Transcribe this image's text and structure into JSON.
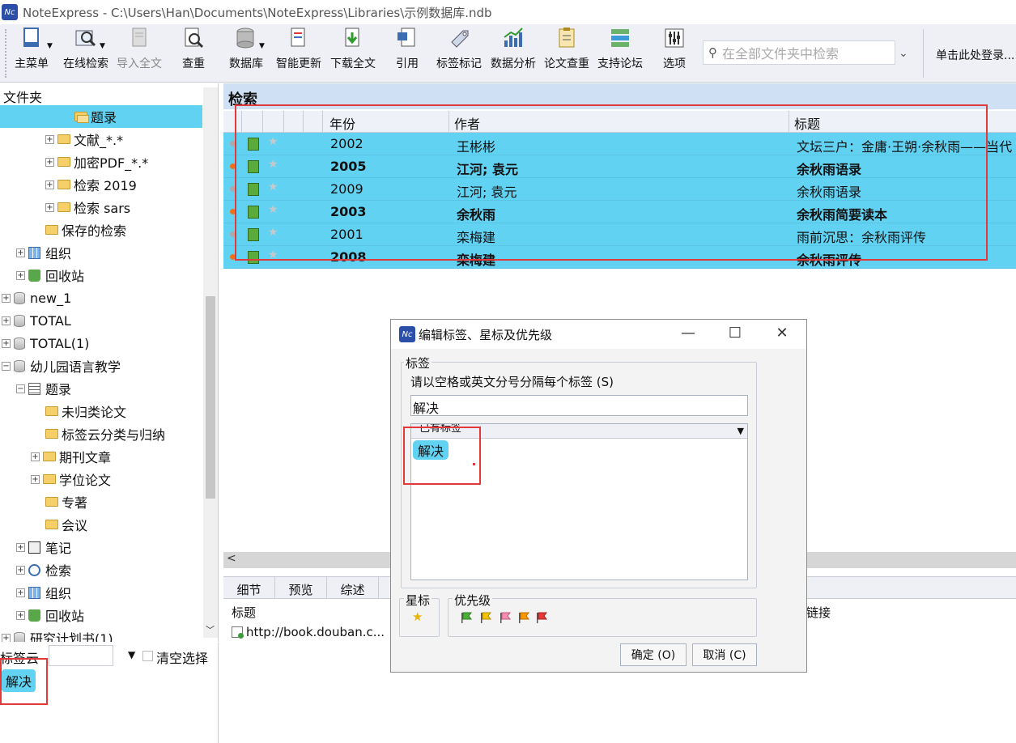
{
  "window": {
    "title": "NoteExpress - C:\\Users\\Han\\Documents\\NoteExpress\\Libraries\\示例数据库.ndb",
    "logo": "Nc"
  },
  "toolbar": {
    "items": [
      "主菜单",
      "在线检索",
      "导入全文",
      "查重",
      "数据库",
      "智能更新",
      "下载全文",
      "引用",
      "标签标记",
      "数据分析",
      "论文查重",
      "支持论坛",
      "选项"
    ],
    "search_placeholder": "在全部文件夹中检索",
    "login": "单击此处登录..."
  },
  "left": {
    "header": "文件夹",
    "tree": [
      {
        "label": "题录"
      },
      {
        "label": "文献_*.*"
      },
      {
        "label": "加密PDF_*.*"
      },
      {
        "label": "检索 2019"
      },
      {
        "label": "检索 sars"
      },
      {
        "label": "保存的检索"
      },
      {
        "label": "组织"
      },
      {
        "label": "回收站"
      },
      {
        "label": "new_1"
      },
      {
        "label": "TOTAL"
      },
      {
        "label": "TOTAL(1)"
      },
      {
        "label": "幼儿园语言教学"
      },
      {
        "label": "题录"
      },
      {
        "label": "未归类论文"
      },
      {
        "label": "标签云分类与归纳"
      },
      {
        "label": "期刊文章"
      },
      {
        "label": "学位论文"
      },
      {
        "label": "专著"
      },
      {
        "label": "会议"
      },
      {
        "label": "笔记"
      },
      {
        "label": "检索"
      },
      {
        "label": "组织"
      },
      {
        "label": "回收站"
      },
      {
        "label": "研究计划书(1)"
      }
    ],
    "tagcloud": {
      "label": "标签云",
      "clear": "清空选择",
      "tag": "解决"
    }
  },
  "main": {
    "header": "检索",
    "columns": [
      "年份",
      "作者",
      "标题"
    ],
    "rows": [
      {
        "year": "2002",
        "author": "王彬彬",
        "title": "文坛三户：金庸·王朔·余秋雨——当代",
        "bold": false
      },
      {
        "year": "2005",
        "author": "江河; 袁元",
        "title": "余秋雨语录",
        "bold": true
      },
      {
        "year": "2009",
        "author": "江河; 袁元",
        "title": "余秋雨语录",
        "bold": false
      },
      {
        "year": "2003",
        "author": "余秋雨",
        "title": "余秋雨简要读本",
        "bold": true
      },
      {
        "year": "2001",
        "author": "栾梅建",
        "title": "雨前沉思：余秋雨评传",
        "bold": false
      },
      {
        "year": "2008",
        "author": "栾梅建",
        "title": "余秋雨评传",
        "bold": true
      }
    ]
  },
  "bottom": {
    "tabs": [
      "细节",
      "预览",
      "综述"
    ],
    "title_col": "标题",
    "link_col": "链接",
    "link": "http://book.douban.c..."
  },
  "dialog": {
    "title": "编辑标签、星标及优先级",
    "tag_group": "标签",
    "hint": "请以空格或英文分号分隔每个标签 (S)",
    "input_value": "解决",
    "list_header": "已有标签",
    "chip": "解决",
    "star_group": "星标",
    "priority_group": "优先级",
    "ok": "确定 (O)",
    "cancel": "取消 (C)",
    "flag_colors": [
      "#4caf3a",
      "#f5c400",
      "#f48fb1",
      "#ff9800",
      "#e53935"
    ]
  }
}
